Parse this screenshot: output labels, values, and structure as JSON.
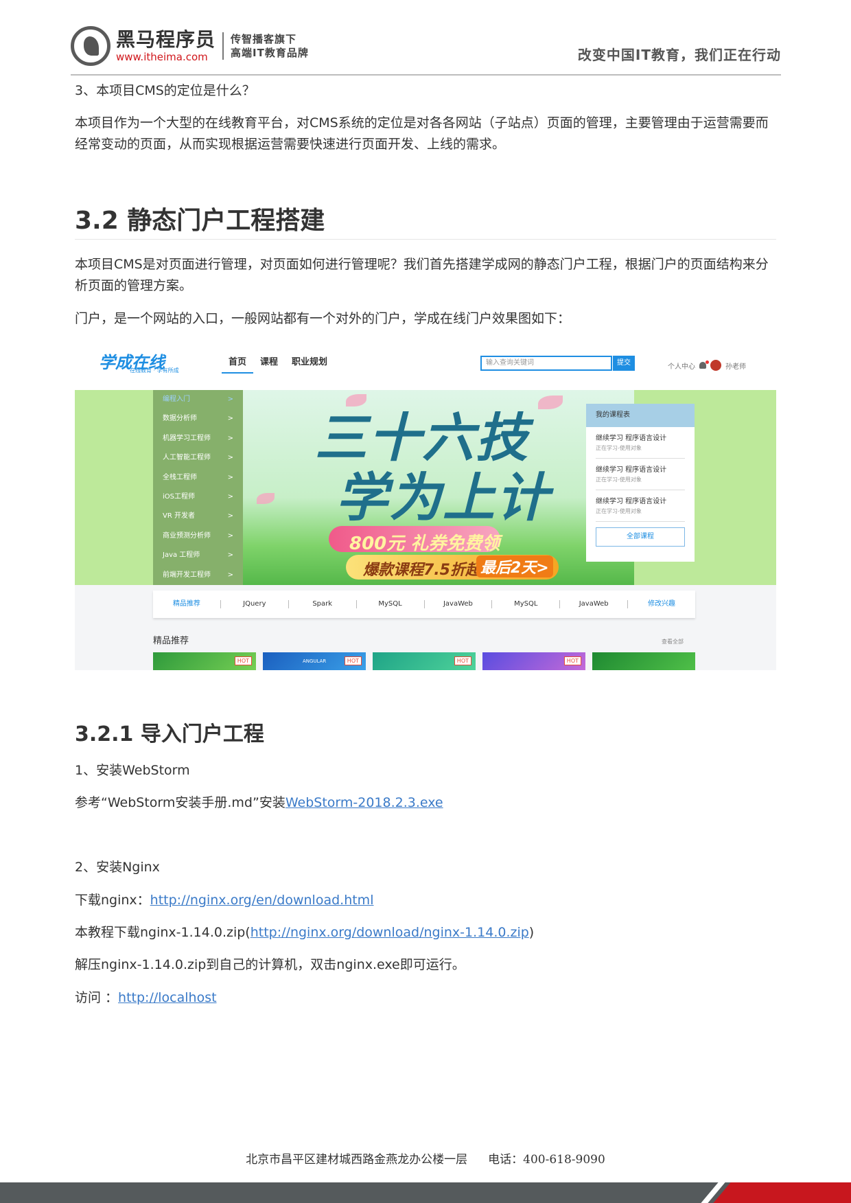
{
  "header": {
    "brand_name": "黑马程序员",
    "brand_url": "www.itheima.com",
    "slogan_line1": "传智播客旗下",
    "slogan_line2": "高端IT教育品牌",
    "tagline": "改变中国IT教育，我们正在行动"
  },
  "content": {
    "q3": "3、本项目CMS的定位是什么？",
    "q3_answer": "本项目作为一个大型的在线教育平台，对CMS系统的定位是对各各网站（子站点）页面的管理，主要管理由于运营需要而经常变动的页面，从而实现根据运营需要快速进行页面开发、上线的需求。",
    "h2": "3.2 静态门户工程搭建",
    "p1": "本项目CMS是对页面进行管理，对页面如何进行管理呢？我们首先搭建学成网的静态门户工程，根据门户的页面结构来分析页面的管理方案。",
    "p2": "门户，是一个网站的入口，一般网站都有一个对外的门户，学成在线门户效果图如下：",
    "h3": "3.2.1 导入门户工程",
    "step1": "1、安装WebStorm",
    "step1_text": "参考“WebStorm安装手册.md”安装",
    "step1_link": "WebStorm-2018.2.3.exe",
    "step2": "2、安装Nginx",
    "download_label": "下载nginx：",
    "download_link": "http://nginx.org/en/download.html",
    "tutorial_prefix": "本教程下载nginx-1.14.0.zip(",
    "tutorial_link": "http://nginx.org/download/nginx-1.14.0.zip",
    "tutorial_suffix": ")",
    "unzip": "解压nginx-1.14.0.zip到自己的计算机，双击nginx.exe即可运行。",
    "visit_label": "访问 ：",
    "visit_link": "http://localhost"
  },
  "portal": {
    "logo": "学成在线",
    "logo_sub": "在线教育 · 学有所成",
    "nav": [
      "首页",
      "课程",
      "职业规划"
    ],
    "search_placeholder": "输入查询关键词",
    "search_button": "提交",
    "user_center": "个人中心",
    "user_name": "孙老师",
    "menu": [
      "编程入门",
      "数据分析师",
      "机器学习工程师",
      "人工智能工程师",
      "全栈工程师",
      "iOS工程师",
      "VR 开发者",
      "商业预测分析师",
      "Java 工程师",
      "前端开发工程师"
    ],
    "menu_arrow": ">",
    "banner_line1": "三十六技",
    "banner_line2": "学为上计",
    "banner_coupon": "800元 礼券免费领",
    "banner_sale": "爆款课程7.5折起",
    "banner_last": "最后2天>",
    "panel_title": "我的课程表",
    "panel_items": [
      {
        "title": "继续学习 程序语言设计",
        "sub": "正在学习-使用对象"
      },
      {
        "title": "继续学习 程序语言设计",
        "sub": "正在学习-使用对象"
      },
      {
        "title": "继续学习 程序语言设计",
        "sub": "正在学习-使用对象"
      }
    ],
    "panel_button": "全部课程",
    "tabs": [
      "精品推荐",
      "JQuery",
      "Spark",
      "MySQL",
      "JavaWeb",
      "MySQL",
      "JavaWeb",
      "修改兴趣"
    ],
    "section_title": "精品推荐",
    "view_all": "查看全部",
    "hot": "HOT",
    "angular": "ANGULAR"
  },
  "footer": {
    "address": "北京市昌平区建材城西路金燕龙办公楼一层",
    "phone": "电话：400-618-9090"
  }
}
